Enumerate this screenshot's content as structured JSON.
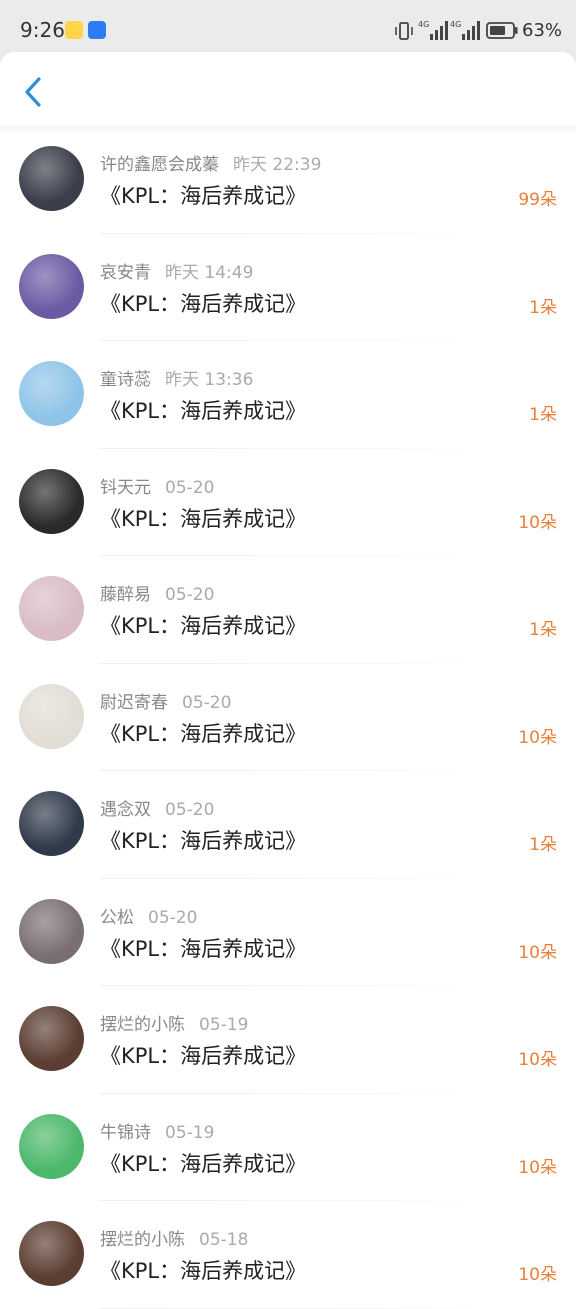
{
  "status_bar": {
    "time": "9:26",
    "network_1": "4G",
    "network_2": "4G",
    "battery_percent": "63%"
  },
  "nav": {
    "back_icon": "chevron-left-icon"
  },
  "colors": {
    "accent_blue": "#2a8fd8",
    "count_orange": "#e8803a",
    "name_gray": "#888888",
    "time_gray": "#aaaaaa",
    "title_dark": "#222222"
  },
  "items": [
    {
      "name": "许的鑫愿会成蓁",
      "time": "昨天 22:39",
      "title": "《KPL：海后养成记》",
      "count": "99朵",
      "avatar_color": "#3a3d4a"
    },
    {
      "name": "哀安青",
      "time": "昨天 14:49",
      "title": "《KPL：海后养成记》",
      "count": "1朵",
      "avatar_color": "#6b5aa3"
    },
    {
      "name": "童诗蕊",
      "time": "昨天 13:36",
      "title": "《KPL：海后养成记》",
      "count": "1朵",
      "avatar_color": "#8fc4e8"
    },
    {
      "name": "钭天元",
      "time": "05-20",
      "title": "《KPL：海后养成记》",
      "count": "10朵",
      "avatar_color": "#2a2a2a"
    },
    {
      "name": "藤醉易",
      "time": "05-20",
      "title": "《KPL：海后养成记》",
      "count": "1朵",
      "avatar_color": "#d9bcc6"
    },
    {
      "name": "尉迟寄春",
      "time": "05-20",
      "title": "《KPL：海后养成记》",
      "count": "10朵",
      "avatar_color": "#e2ddd5"
    },
    {
      "name": "遇念双",
      "time": "05-20",
      "title": "《KPL：海后养成记》",
      "count": "1朵",
      "avatar_color": "#2f3a4a"
    },
    {
      "name": "公松",
      "time": "05-20",
      "title": "《KPL：海后养成记》",
      "count": "10朵",
      "avatar_color": "#7a6f70"
    },
    {
      "name": "摆烂的小陈",
      "time": "05-19",
      "title": "《KPL：海后养成记》",
      "count": "10朵",
      "avatar_color": "#5b3d32"
    },
    {
      "name": "牛锦诗",
      "time": "05-19",
      "title": "《KPL：海后养成记》",
      "count": "10朵",
      "avatar_color": "#4bb86a"
    },
    {
      "name": "摆烂的小陈",
      "time": "05-18",
      "title": "《KPL：海后养成记》",
      "count": "10朵",
      "avatar_color": "#5b3d32"
    }
  ]
}
